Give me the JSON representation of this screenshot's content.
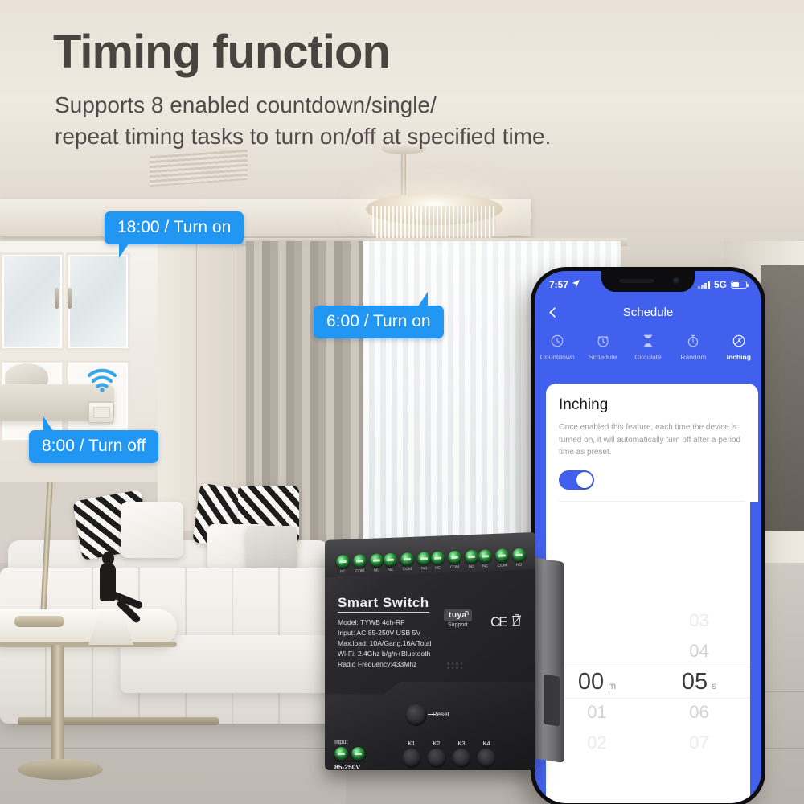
{
  "header": {
    "title": "Timing function",
    "subtitle": "Supports 8 enabled countdown/single/\nrepeat timing tasks to turn on/off at specified time."
  },
  "colors": {
    "callout_blue": "#2196F3",
    "app_blue": "#4260EE",
    "toggle_on": "#4260EE",
    "title_text": "#4A4340"
  },
  "callouts": [
    {
      "label": "18:00 / Turn on",
      "name": "callout-18-00-turn-on"
    },
    {
      "label": "6:00 / Turn on",
      "name": "callout-6-00-turn-on"
    },
    {
      "label": "8:00 / Turn off",
      "name": "callout-8-00-turn-off"
    }
  ],
  "phone": {
    "status_bar": {
      "time": "7:57",
      "network": "5G"
    },
    "nav": {
      "back_icon": "chevron-left-icon",
      "title": "Schedule"
    },
    "tabs": [
      {
        "label": "Countdown",
        "icon": "clock-icon",
        "active": false
      },
      {
        "label": "Schedule",
        "icon": "alarm-clock-icon",
        "active": false
      },
      {
        "label": "Circulate",
        "icon": "hourglass-icon",
        "active": false
      },
      {
        "label": "Random",
        "icon": "stopwatch-icon",
        "active": false
      },
      {
        "label": "Inching",
        "icon": "clock-arrow-icon",
        "active": true
      }
    ],
    "card": {
      "title": "Inching",
      "description": "Once enabled this feature,  each time the device is turned on, it will automatically turn off after a period time as preset.",
      "toggle_state": "on"
    },
    "picker": {
      "minutes": {
        "unit": "m",
        "selected": "00",
        "options": [
          "01",
          "02"
        ]
      },
      "seconds": {
        "unit": "s",
        "selected": "05",
        "above": [
          "03",
          "04"
        ],
        "below": [
          "06",
          "07"
        ]
      }
    }
  },
  "device": {
    "brand_title": "Smart Switch",
    "specs": [
      "Model:  TYWB 4ch-RF",
      "Input:  AC 85-250V USB 5V",
      "Max.load:  10A/Gang.16A/Total",
      "Wi-Fi:  2.4Ghz b/g/n+Bluetooth",
      "Radio Frequency:433Mhz"
    ],
    "tuya": {
      "logo": "tuya",
      "sub": "Support"
    },
    "certs": [
      "CE",
      "weee-bin-icon"
    ],
    "terminal_groups": [
      [
        "NC",
        "COM",
        "NO"
      ],
      [
        "NC",
        "COM",
        "NO"
      ],
      [
        "NC",
        "COM",
        "NO"
      ],
      [
        "NC",
        "COM",
        "NO"
      ]
    ],
    "reset_label": "Reset",
    "keys": [
      "K1",
      "K2",
      "K3",
      "K4"
    ],
    "input_label": "Input",
    "input_voltage": "85-250V"
  },
  "scene": {
    "wifi_icon": "wifi-signal-icon"
  }
}
